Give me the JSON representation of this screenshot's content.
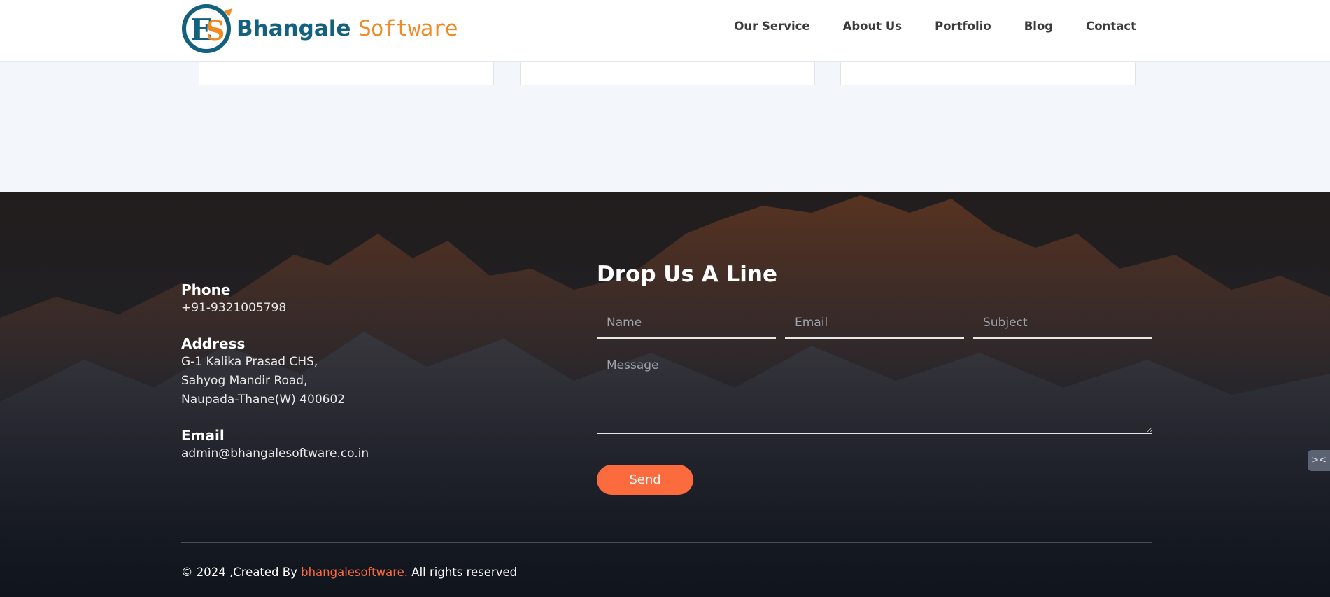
{
  "brand": {
    "name_part1": "Bhangale",
    "name_part2": "Software",
    "colors": {
      "primary": "#13617e",
      "accent": "#f08a24"
    }
  },
  "nav": {
    "items": [
      {
        "label": "Our Service"
      },
      {
        "label": "About Us"
      },
      {
        "label": "Portfolio"
      },
      {
        "label": "Blog"
      },
      {
        "label": "Contact"
      }
    ]
  },
  "contact": {
    "phone_title": "Phone",
    "phone": "+91-9321005798",
    "address_title": "Address",
    "address_lines": [
      "G-1 Kalika Prasad CHS,",
      "Sahyog Mandir Road,",
      "Naupada-Thane(W) 400602"
    ],
    "email_title": "Email",
    "email": "admin@bhangalesoftware.co.in"
  },
  "form": {
    "title": "Drop Us A Line",
    "name_placeholder": "Name",
    "email_placeholder": "Email",
    "subject_placeholder": "Subject",
    "message_placeholder": "Message",
    "send_label": "Send",
    "button_color": "#fb6b3d"
  },
  "footer": {
    "copyright_prefix": "© 2024 ,Created By ",
    "copyright_link": "bhangalesoftware.",
    "copyright_suffix": " All rights reserved"
  },
  "widget": {
    "icon": "collapse-arrows-icon"
  }
}
